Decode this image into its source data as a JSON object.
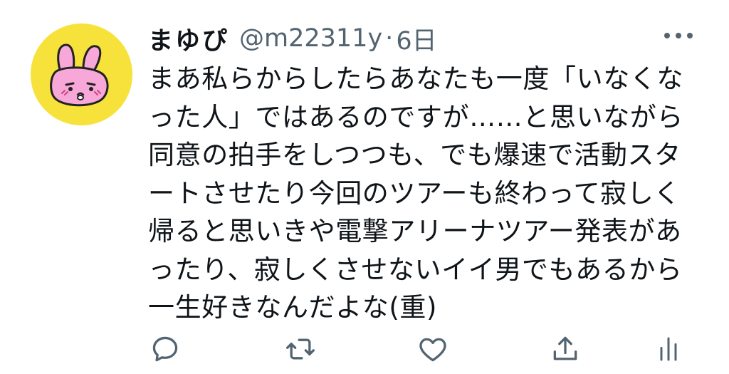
{
  "tweet": {
    "display_name": "まゆぴ",
    "handle": "@m22311y",
    "separator": "·",
    "time": "6日",
    "body_lines": [
      "まあ私らからしたらあなたも一度「いなくな",
      "った人」ではあるのですが……と思いながら",
      "同意の拍手をしつつも、でも爆速で活動スタ",
      "ートさせたり今回のツアーも終わって寂しく",
      "帰ると思いきや電撃アリーナツアー発表があ",
      "ったり、寂しくさせないイイ男でもあるから",
      "一生好きなんだよな(重)"
    ]
  },
  "icons": {
    "avatar": "pink-bunny-avatar",
    "more": "more-dots-icon",
    "actions": [
      "reply-icon",
      "retweet-icon",
      "like-icon",
      "share-icon",
      "views-icon"
    ]
  },
  "colors": {
    "text": "#0f1419",
    "secondary": "#536471",
    "avatar_bg": "#f7e23b",
    "bunny_pink": "#f7a8d8"
  }
}
